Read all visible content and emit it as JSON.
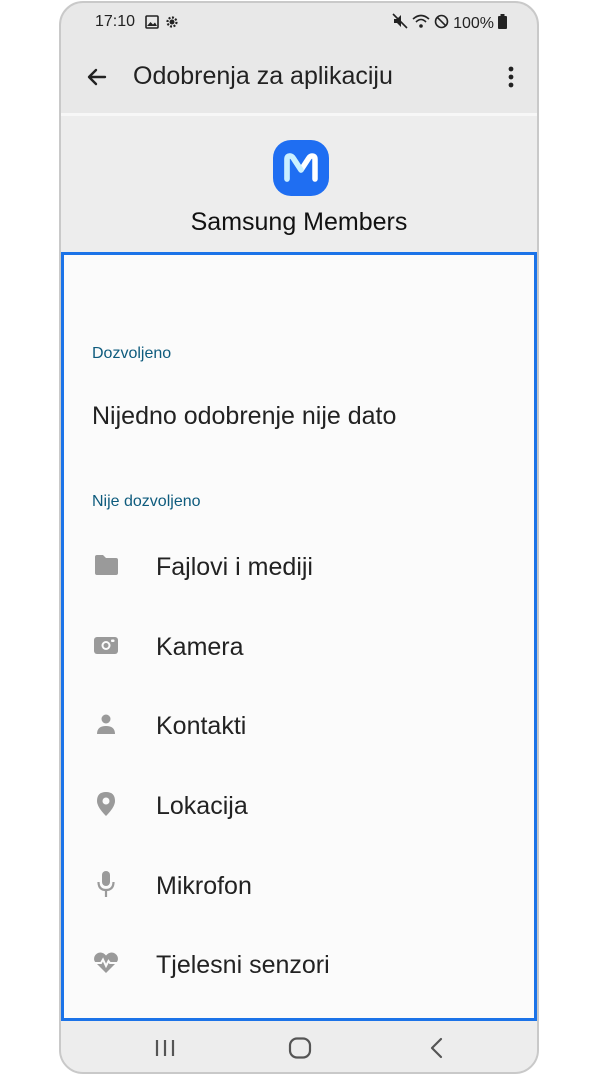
{
  "status_bar": {
    "time": "17:10",
    "battery": "100%",
    "left_icons": [
      "image-icon",
      "gear-icon"
    ],
    "right_icons": [
      "mute-icon",
      "wifi-icon",
      "do-not-disturb-icon",
      "battery-icon"
    ]
  },
  "app_bar": {
    "title": "Odobrenja za aplikaciju",
    "back_icon": "back-arrow-icon",
    "more_icon": "more-vert-icon"
  },
  "app": {
    "name": "Samsung Members",
    "icon": "samsung-members-icon",
    "icon_color": "#1f6ef2"
  },
  "permissions": {
    "granted_header": "Dozvoljeno",
    "granted_empty": "Nijedno odobrenje nije dato",
    "denied_header": "Nije dozvoljeno",
    "denied": [
      {
        "label": "Fajlovi i mediji",
        "icon": "folder-icon"
      },
      {
        "label": "Kamera",
        "icon": "camera-icon"
      },
      {
        "label": "Kontakti",
        "icon": "person-icon"
      },
      {
        "label": "Lokacija",
        "icon": "location-pin-icon"
      },
      {
        "label": "Mikrofon",
        "icon": "microphone-icon"
      },
      {
        "label": "Tjelesni senzori",
        "icon": "heart-rate-icon"
      }
    ]
  },
  "nav_bar": {
    "icons": [
      "recent-apps-icon",
      "home-icon",
      "back-icon"
    ]
  },
  "colors": {
    "highlight": "#1b73e8",
    "section_label": "#0e5b7d",
    "icon_gray": "#9a9a9a"
  }
}
